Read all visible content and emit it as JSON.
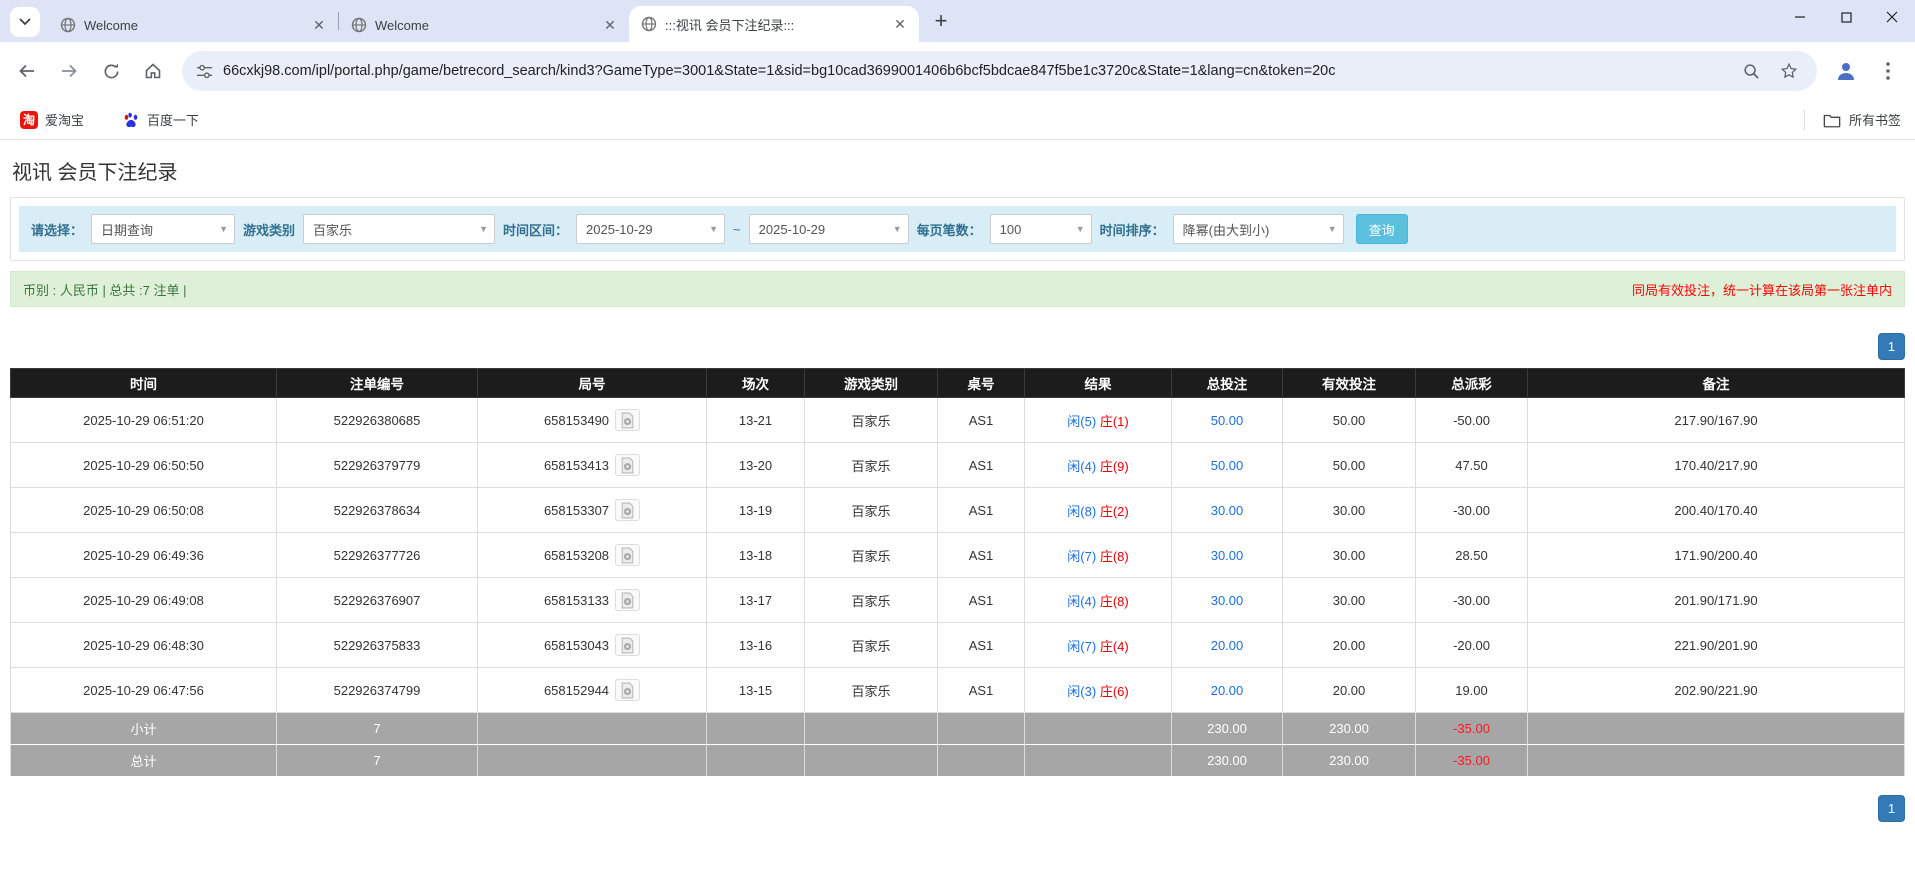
{
  "browser": {
    "tabs": [
      {
        "title": "Welcome"
      },
      {
        "title": "Welcome"
      },
      {
        "title": ":::视讯 会员下注纪录:::"
      }
    ],
    "url": "66cxkj98.com/ipl/portal.php/game/betrecord_search/kind3?GameType=3001&State=1&sid=bg10cad3699001406b6bcf5bdcae847f5be1c3720c&State=1&lang=cn&token=20c",
    "bookmarks": [
      {
        "label": "爱淘宝",
        "icon": "taobao-icon"
      },
      {
        "label": "百度一下",
        "icon": "baidu-icon"
      }
    ],
    "all_bookmarks_label": "所有书签"
  },
  "page": {
    "title": "视讯 会员下注纪录",
    "filters": {
      "choose_label": "请选择：",
      "choose_value": "日期查询",
      "game_type_label": "游戏类别",
      "game_type_value": "百家乐",
      "time_range_label": "时间区间：",
      "date_from": "2025-10-29",
      "tilde": "~",
      "date_to": "2025-10-29",
      "page_size_label": "每页笔数：",
      "page_size_value": "100",
      "sort_label": "时间排序：",
      "sort_value": "降幂(由大到小)",
      "query_button": "查询"
    },
    "summary": {
      "left": "币别 : 人民币 | 总共 :7 注单 |",
      "right": "同局有效投注，统一计算在该局第一张注单内"
    },
    "pagination": {
      "page": "1"
    },
    "table": {
      "headers": [
        "时间",
        "注单编号",
        "局号",
        "场次",
        "游戏类别",
        "桌号",
        "结果",
        "总投注",
        "有效投注",
        "总派彩",
        "备注"
      ],
      "rows": [
        {
          "time": "2025-10-29 06:51:20",
          "bet_no": "522926380685",
          "round_no": "658153490",
          "session": "13-21",
          "game": "百家乐",
          "table_no": "AS1",
          "result_player": "闲(5)",
          "result_banker": "庄(1)",
          "total_bet": "50.00",
          "valid_bet": "50.00",
          "payout": "-50.00",
          "remark": "217.90/167.90"
        },
        {
          "time": "2025-10-29 06:50:50",
          "bet_no": "522926379779",
          "round_no": "658153413",
          "session": "13-20",
          "game": "百家乐",
          "table_no": "AS1",
          "result_player": "闲(4)",
          "result_banker": "庄(9)",
          "total_bet": "50.00",
          "valid_bet": "50.00",
          "payout": "47.50",
          "remark": "170.40/217.90"
        },
        {
          "time": "2025-10-29 06:50:08",
          "bet_no": "522926378634",
          "round_no": "658153307",
          "session": "13-19",
          "game": "百家乐",
          "table_no": "AS1",
          "result_player": "闲(8)",
          "result_banker": "庄(2)",
          "total_bet": "30.00",
          "valid_bet": "30.00",
          "payout": "-30.00",
          "remark": "200.40/170.40"
        },
        {
          "time": "2025-10-29 06:49:36",
          "bet_no": "522926377726",
          "round_no": "658153208",
          "session": "13-18",
          "game": "百家乐",
          "table_no": "AS1",
          "result_player": "闲(7)",
          "result_banker": "庄(8)",
          "total_bet": "30.00",
          "valid_bet": "30.00",
          "payout": "28.50",
          "remark": "171.90/200.40"
        },
        {
          "time": "2025-10-29 06:49:08",
          "bet_no": "522926376907",
          "round_no": "658153133",
          "session": "13-17",
          "game": "百家乐",
          "table_no": "AS1",
          "result_player": "闲(4)",
          "result_banker": "庄(8)",
          "total_bet": "30.00",
          "valid_bet": "30.00",
          "payout": "-30.00",
          "remark": "201.90/171.90"
        },
        {
          "time": "2025-10-29 06:48:30",
          "bet_no": "522926375833",
          "round_no": "658153043",
          "session": "13-16",
          "game": "百家乐",
          "table_no": "AS1",
          "result_player": "闲(7)",
          "result_banker": "庄(4)",
          "total_bet": "20.00",
          "valid_bet": "20.00",
          "payout": "-20.00",
          "remark": "221.90/201.90"
        },
        {
          "time": "2025-10-29 06:47:56",
          "bet_no": "522926374799",
          "round_no": "658152944",
          "session": "13-15",
          "game": "百家乐",
          "table_no": "AS1",
          "result_player": "闲(3)",
          "result_banker": "庄(6)",
          "total_bet": "20.00",
          "valid_bet": "20.00",
          "payout": "19.00",
          "remark": "202.90/221.90"
        }
      ],
      "subtotal": {
        "label": "小计",
        "count": "7",
        "total_bet": "230.00",
        "valid_bet": "230.00",
        "payout": "-35.00"
      },
      "total": {
        "label": "总计",
        "count": "7",
        "total_bet": "230.00",
        "valid_bet": "230.00",
        "payout": "-35.00"
      }
    }
  }
}
